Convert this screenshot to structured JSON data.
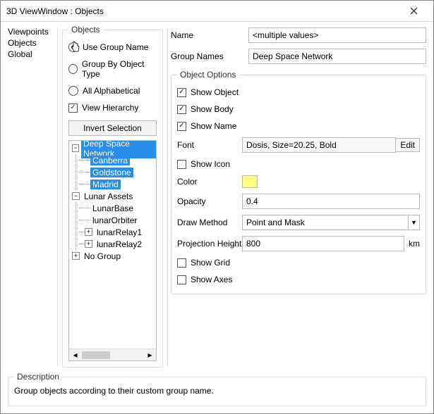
{
  "window": {
    "title": "3D ViewWindow : Objects"
  },
  "leftNav": {
    "items": [
      "Viewpoints",
      "Objects",
      "Global"
    ]
  },
  "objectsPanel": {
    "legend": "Objects",
    "radios": {
      "useGroupName": "Use Group Name",
      "groupByType": "Group By Object Type",
      "allAlpha": "All Alphabetical"
    },
    "viewHierarchy": "View Hierarchy",
    "invertSelection": "Invert Selection"
  },
  "tree": {
    "group1": {
      "label": "Deep Space Network",
      "children": [
        "Canberra",
        "Goldstone",
        "Madrid"
      ]
    },
    "group2": {
      "label": "Lunar Assets",
      "children": [
        "LunarBase",
        "lunarOrbiter",
        "lunarRelay1",
        "lunarRelay2"
      ]
    },
    "group3": {
      "label": "No Group"
    }
  },
  "rightPanel": {
    "nameLabel": "Name",
    "nameValue": "<multiple values>",
    "groupNamesLabel": "Group Names",
    "groupNamesValue": "Deep Space Network",
    "optionsLegend": "Object Options",
    "showObject": "Show Object",
    "showBody": "Show Body",
    "showName": "Show Name",
    "fontLabel": "Font",
    "fontValue": "Dosis, Size=20.25, Bold",
    "editBtn": "Edit",
    "showIcon": "Show Icon",
    "colorLabel": "Color",
    "opacityLabel": "Opacity",
    "opacityValue": "0.4",
    "drawMethodLabel": "Draw Method",
    "drawMethodValue": "Point and Mask",
    "projHeightLabel": "Projection Height",
    "projHeightValue": "800",
    "projHeightUnit": "km",
    "showGrid": "Show Grid",
    "showAxes": "Show Axes"
  },
  "description": {
    "legend": "Description",
    "text": "Group objects according to their custom group name."
  }
}
